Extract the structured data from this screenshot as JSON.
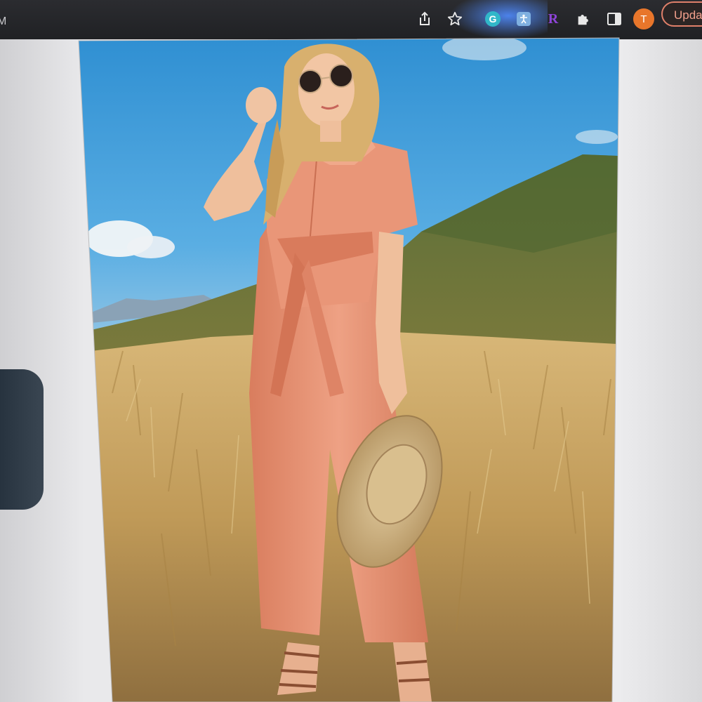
{
  "browser": {
    "url_fragment": "M",
    "toolbar_icons": [
      "share-icon",
      "bookmark-star-icon",
      "grammarly-extension-icon",
      "accessibility-extension-icon",
      "r-extension-icon",
      "extensions-puzzle-icon",
      "side-panel-icon"
    ],
    "grammarly_letter": "G",
    "r_extension_letter": "R",
    "profile_initial": "T",
    "update_label": "Upda",
    "colors": {
      "toolbar": "#202124",
      "profile_avatar": "#e8762b",
      "update_border": "#e0806a"
    }
  },
  "product_image": {
    "subject": "model-in-coral-belted-jumpsuit-holding-straw-hat",
    "colors": {
      "garment": "#e8906e",
      "sky": "#3f9bd6",
      "grass": "#c9a25c"
    }
  }
}
